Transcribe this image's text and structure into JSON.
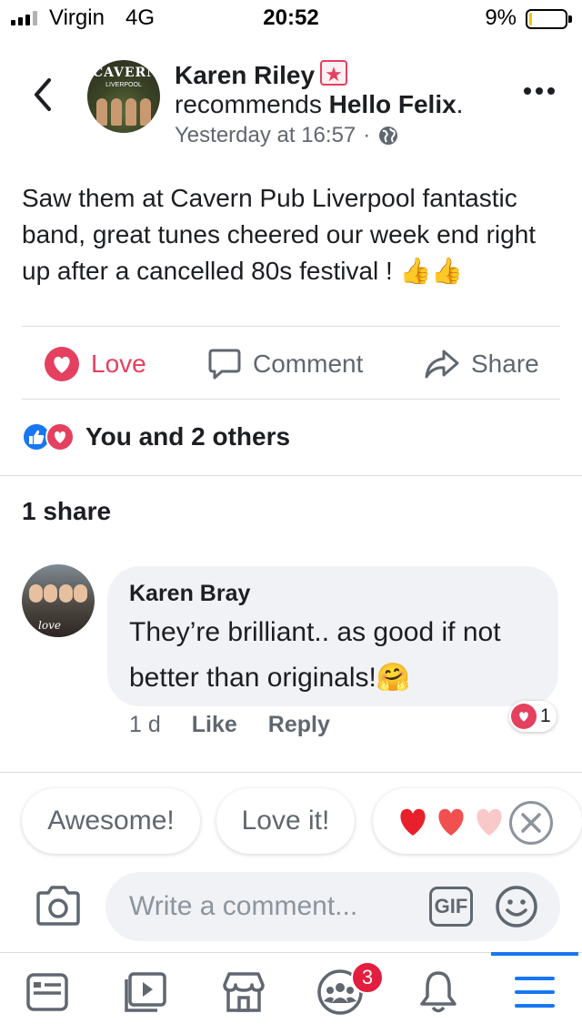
{
  "status_bar": {
    "carrier": "Virgin",
    "network": "4G",
    "time": "20:52",
    "battery_percent": "9%",
    "battery_level": 0.09
  },
  "post": {
    "author": "Karen Riley",
    "avatar_text_top": "CAVERN",
    "avatar_text_bottom": "LIVERPOOL",
    "action_verb": "recommends",
    "target": "Hello Felix",
    "timestamp": "Yesterday at 16:57",
    "separator": "·",
    "text": "Saw them at Cavern Pub Liverpool fantastic band, great tunes cheered our week end right up after a cancelled 80s festival ! 👍👍"
  },
  "actions": {
    "love_label": "Love",
    "comment_label": "Comment",
    "share_label": "Share"
  },
  "reactions": {
    "summary": "You and 2 others"
  },
  "shares": {
    "count_label": "1 share"
  },
  "comment": {
    "author": "Karen Bray",
    "avatar_script_text": "love",
    "text": "They’re brilliant.. as good if not better than originals!🤗",
    "age": "1 d",
    "like_label": "Like",
    "reply_label": "Reply",
    "reaction_count": "1"
  },
  "quick_replies": {
    "chip_1": "Awesome!",
    "chip_2": "Love it!",
    "chip_3_emoji": "❤️❤️🤍"
  },
  "composer": {
    "placeholder": "Write a comment...",
    "gif_label": "GIF"
  },
  "tab_bar": {
    "notifications_badge": "3"
  },
  "colors": {
    "facebook_blue": "#1877f2",
    "love_red": "#e4405f",
    "badge_red": "#e41e3f",
    "battery_yellow": "#f5c400"
  }
}
